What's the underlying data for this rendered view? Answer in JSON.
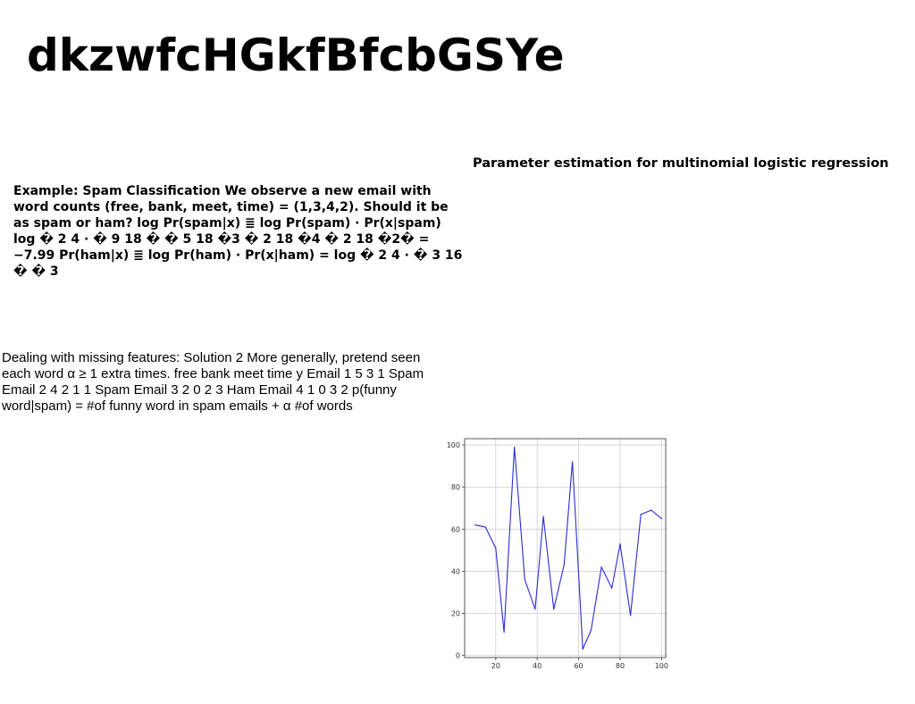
{
  "document": {
    "title": "dkzwfcHGkfBfcbGSYe",
    "heading_right": "Parameter estimation for multinomial logistic regression",
    "paragraph_bold": "Example: Spam Classification We observe a new email with word counts (free, bank, meet, time) = (1,3,4,2). Should it be as spam or ham? log Pr(spam|x) ≣ log Pr(spam) · Pr(x|spam) log � 2 4 · � 9 18 � � 5 18 �3 � 2 18 �4 � 2 18 �2� = −7.99 Pr(ham|x) ≣ log Pr(ham) · Pr(x|ham) = log � 2 4 · � 3 16 � � 3",
    "paragraph_plain": "Dealing with missing features: Solution 2 More generally, pretend seen each word α ≥ 1 extra times. free bank meet time y Email 1 5 3 1 Spam Email 2 4 2 1 1 Spam Email 3 2 0 2 3 Ham Email 4 1 0 3 2 p(funny word|spam) = #of funny word in spam emails + α #of words"
  },
  "chart_data": {
    "type": "line",
    "x": [
      10,
      15,
      20,
      24,
      29,
      34,
      39,
      43,
      48,
      53,
      57,
      62,
      66,
      71,
      76,
      80,
      85,
      90,
      95,
      100
    ],
    "series": [
      {
        "values": [
          62,
          61,
          51,
          11,
          99,
          36,
          22,
          66,
          22,
          43,
          92,
          3,
          12,
          42,
          32,
          53,
          19,
          67,
          69,
          65
        ],
        "color": "#2a2ad8"
      }
    ],
    "xlim": [
      5,
      102
    ],
    "ylim": [
      -1,
      103
    ],
    "xticks": [
      20,
      40,
      60,
      80,
      100
    ],
    "yticks": [
      0,
      20,
      40,
      60,
      80,
      100
    ],
    "grid": true,
    "title": "",
    "xlabel": "",
    "ylabel": ""
  }
}
